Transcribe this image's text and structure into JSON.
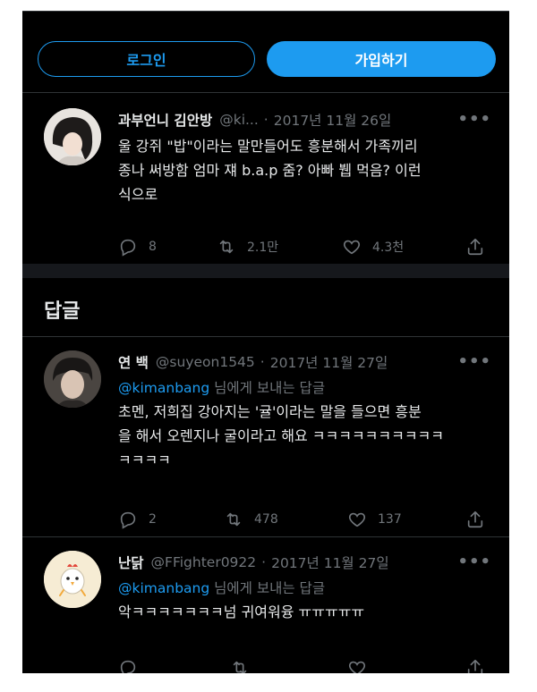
{
  "auth": {
    "login_label": "로그인",
    "signup_label": "가입하기"
  },
  "main_tweet": {
    "name": "과부언니 김안방",
    "handle": "@ki...",
    "date": "2017년 11월 26일",
    "text_lines": [
      "울 강쥐 \"밥\"이라는 말만들어도 흥분해서 가족끼리",
      "종나 써방함 엄마 쟤  b.a.p 줌? 아빠 뷉 먹음? 이런",
      "식으로"
    ],
    "reply_count": "8",
    "retweet_count": "2.1만",
    "like_count": "4.3천"
  },
  "replies_heading": "답글",
  "replies": [
    {
      "name": "연 백",
      "handle": "@suyeon1545",
      "date": "2017년 11월 27일",
      "reply_mention": "@kimanbang",
      "reply_suffix": "님에게 보내는 답글",
      "text_lines": [
        "초멘, 저희집 강아지는 '귤'이라는 말을 들으면 흥분",
        "을 해서 오렌지나 굴이라고 해요 ㅋㅋㅋㅋㅋㅋㅋㅋㅋㅋ",
        "ㅋㅋㅋㅋ"
      ],
      "reply_count": "2",
      "retweet_count": "478",
      "like_count": "137"
    },
    {
      "name": "난닭",
      "handle": "@FFighter0922",
      "date": "2017년 11월 27일",
      "reply_mention": "@kimanbang",
      "reply_suffix": "님에게 보내는 답글",
      "text_lines": [
        "악ㅋㅋㅋㅋㅋㅋㅋ넘 귀여워융 ㅠㅠㅠㅠㅠ"
      ],
      "reply_count": "",
      "retweet_count": "",
      "like_count": ""
    }
  ],
  "icons": {
    "more": "more-icon",
    "reply": "reply-icon",
    "retweet": "retweet-icon",
    "like": "heart-icon",
    "share": "share-icon"
  },
  "colors": {
    "accent": "#1d9bf0",
    "background": "#000000",
    "muted": "#71767b"
  }
}
